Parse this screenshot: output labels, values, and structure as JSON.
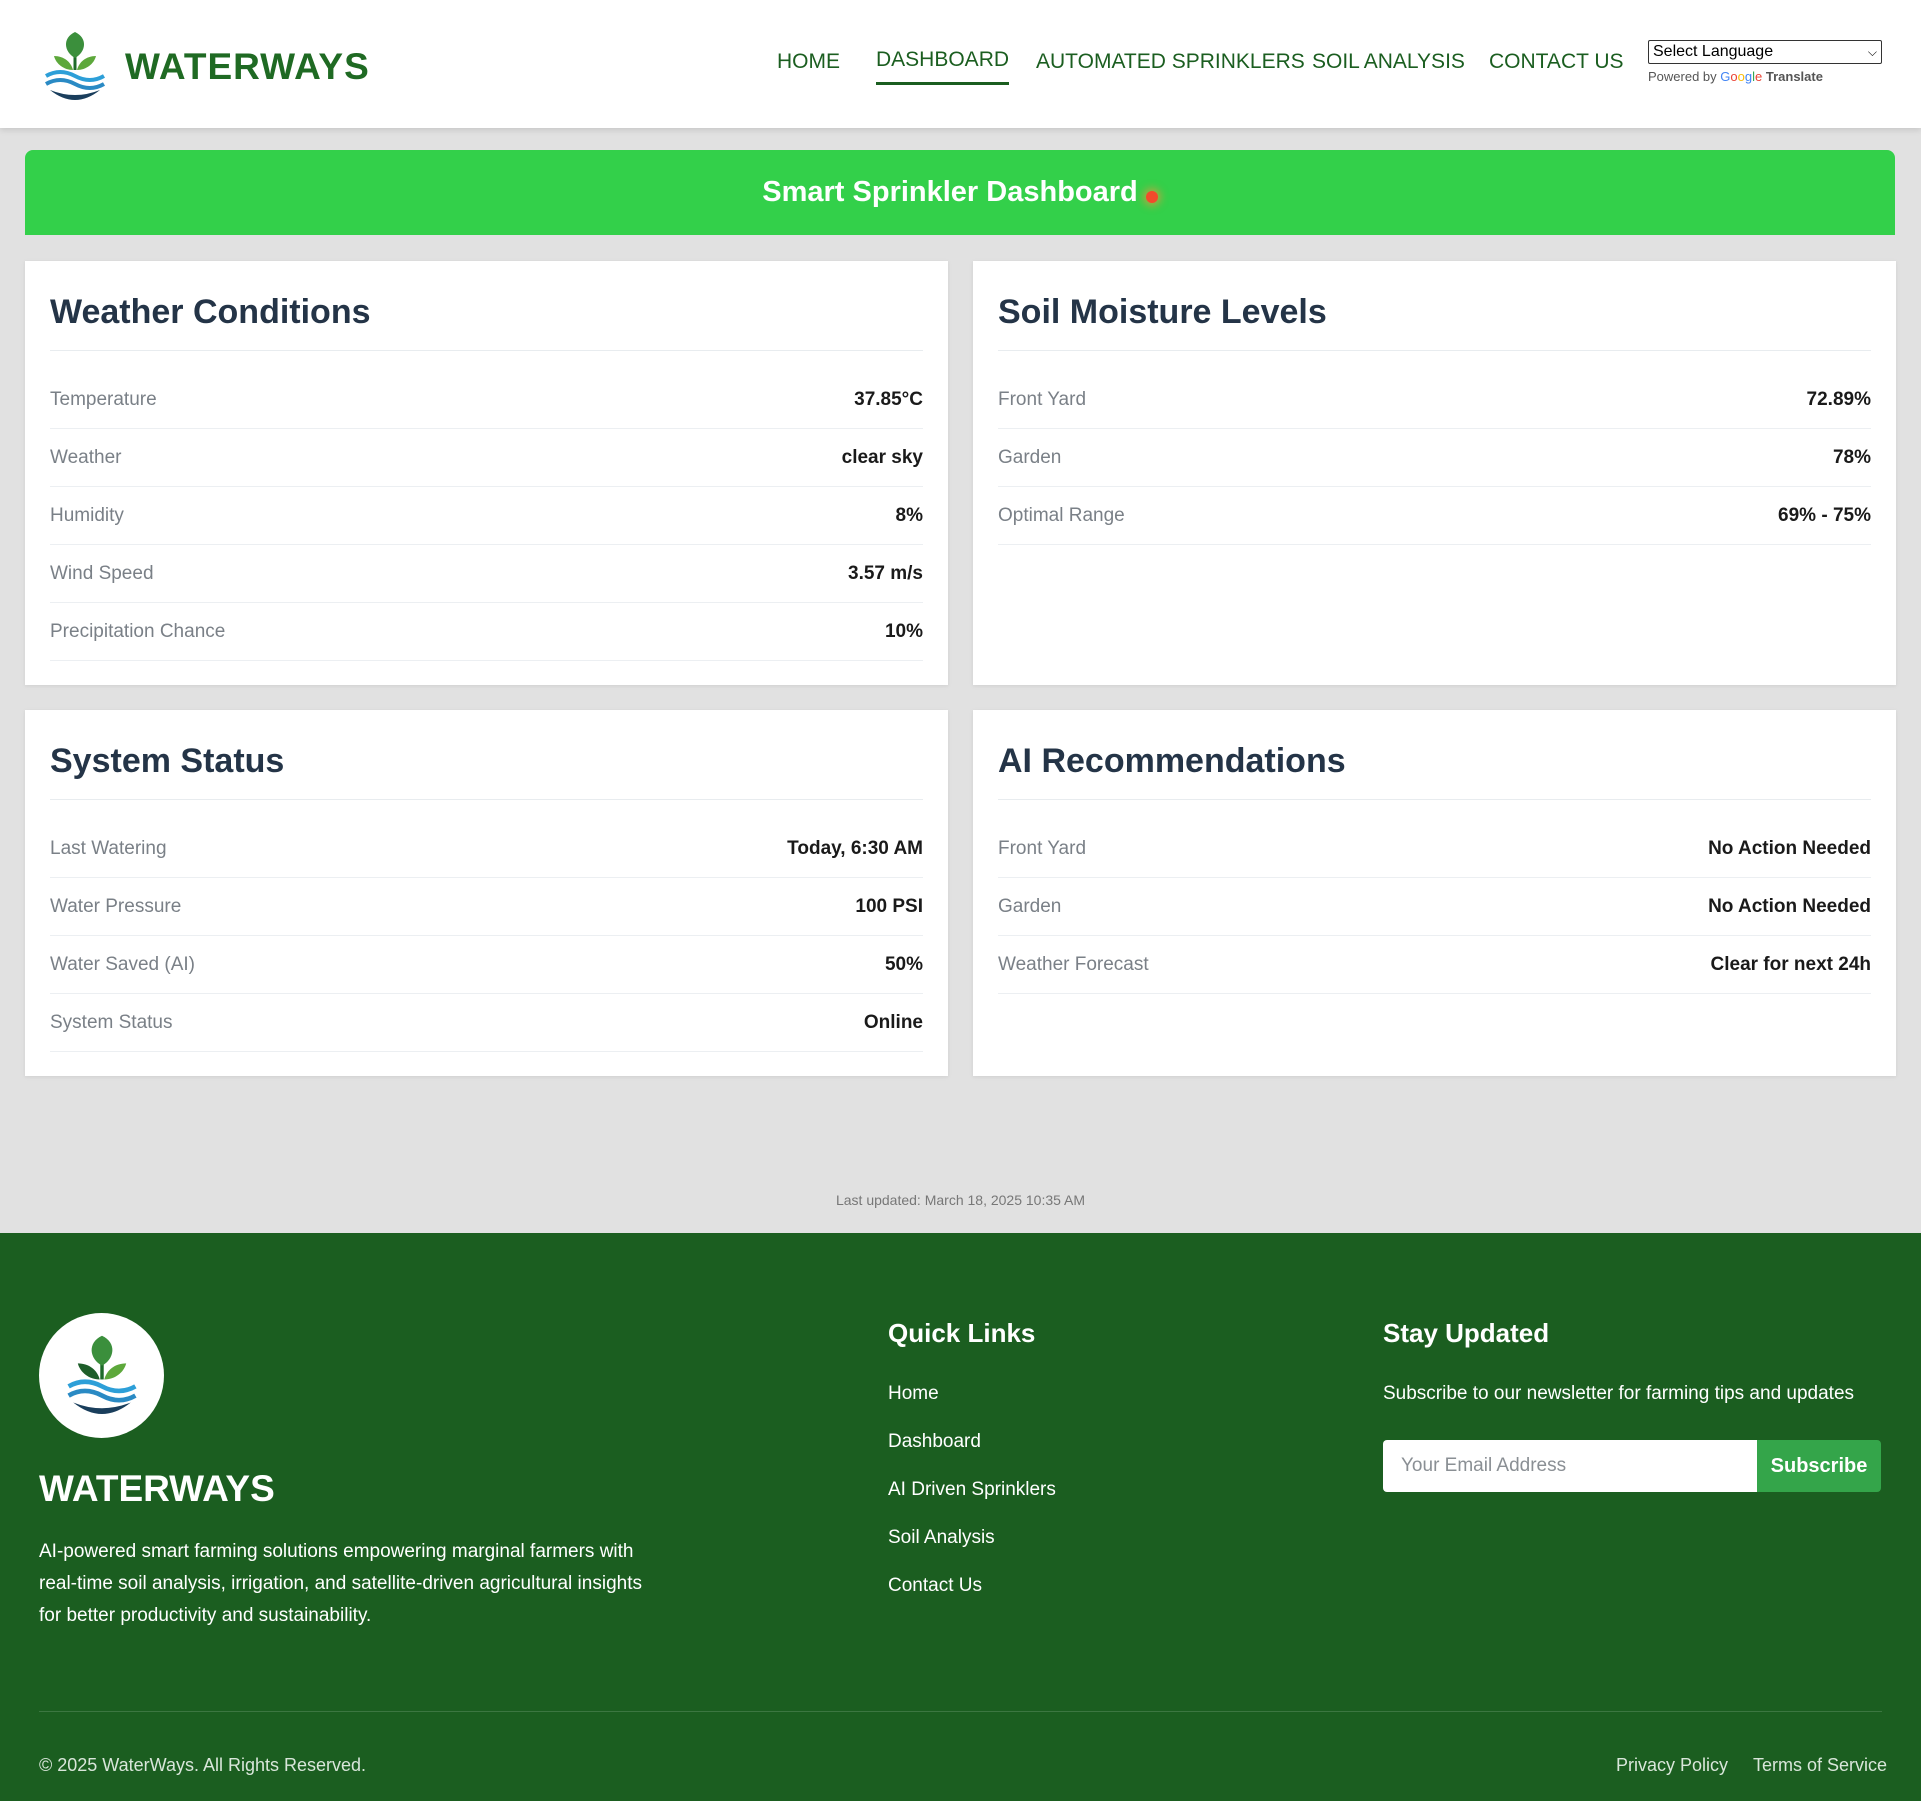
{
  "header": {
    "brand": "WATERWAYS",
    "nav": [
      "HOME",
      "DASHBOARD",
      "AUTOMATED SPRINKLERS",
      "SOIL ANALYSIS",
      "CONTACT US"
    ],
    "active_nav": "DASHBOARD",
    "translate": {
      "select_label": "Select Language",
      "powered_by": "Powered by",
      "google": [
        "G",
        "o",
        "o",
        "g",
        "l",
        "e"
      ],
      "translate_word": "Translate"
    }
  },
  "banner": {
    "title": "Smart Sprinkler Dashboard"
  },
  "cards": {
    "weather": {
      "title": "Weather Conditions",
      "rows": [
        {
          "label": "Temperature",
          "value": "37.85°C"
        },
        {
          "label": "Weather",
          "value": "clear sky"
        },
        {
          "label": "Humidity",
          "value": "8%"
        },
        {
          "label": "Wind Speed",
          "value": "3.57 m/s"
        },
        {
          "label": "Precipitation Chance",
          "value": "10%"
        }
      ]
    },
    "soil": {
      "title": "Soil Moisture Levels",
      "rows": [
        {
          "label": "Front Yard",
          "value": "72.89%"
        },
        {
          "label": "Garden",
          "value": "78%"
        },
        {
          "label": "Optimal Range",
          "value": "69% - 75%"
        }
      ]
    },
    "system": {
      "title": "System Status",
      "rows": [
        {
          "label": "Last Watering",
          "value": "Today, 6:30 AM"
        },
        {
          "label": "Water Pressure",
          "value": "100 PSI"
        },
        {
          "label": "Water Saved (AI)",
          "value": "50%"
        },
        {
          "label": "System Status",
          "value": "Online"
        }
      ]
    },
    "ai": {
      "title": "AI Recommendations",
      "rows": [
        {
          "label": "Front Yard",
          "value": "No Action Needed"
        },
        {
          "label": "Garden",
          "value": "No Action Needed"
        },
        {
          "label": "Weather Forecast",
          "value": "Clear for next 24h"
        }
      ]
    }
  },
  "last_updated": "Last updated: March 18, 2025 10:35 AM",
  "footer": {
    "brand": "WATERWAYS",
    "description": "AI-powered smart farming solutions empowering marginal farmers with real-time soil analysis, irrigation, and satellite-driven agricultural insights for better productivity and sustainability.",
    "quick_links_title": "Quick Links",
    "quick_links": [
      "Home",
      "Dashboard",
      "AI Driven Sprinklers",
      "Soil Analysis",
      "Contact Us"
    ],
    "newsletter_title": "Stay Updated",
    "newsletter_text": "Subscribe to our newsletter for farming tips and updates",
    "email_placeholder": "Your Email Address",
    "subscribe_label": "Subscribe",
    "copyright": "© 2025 WaterWays. All Rights Reserved.",
    "privacy": "Privacy Policy",
    "terms": "Terms of Service"
  },
  "colors": {
    "brand_green": "#1f6a23",
    "banner_green": "#33d04a",
    "footer_green": "#1b5e20",
    "subscribe_green": "#34a54a",
    "status_dot": "#f24a2b"
  }
}
